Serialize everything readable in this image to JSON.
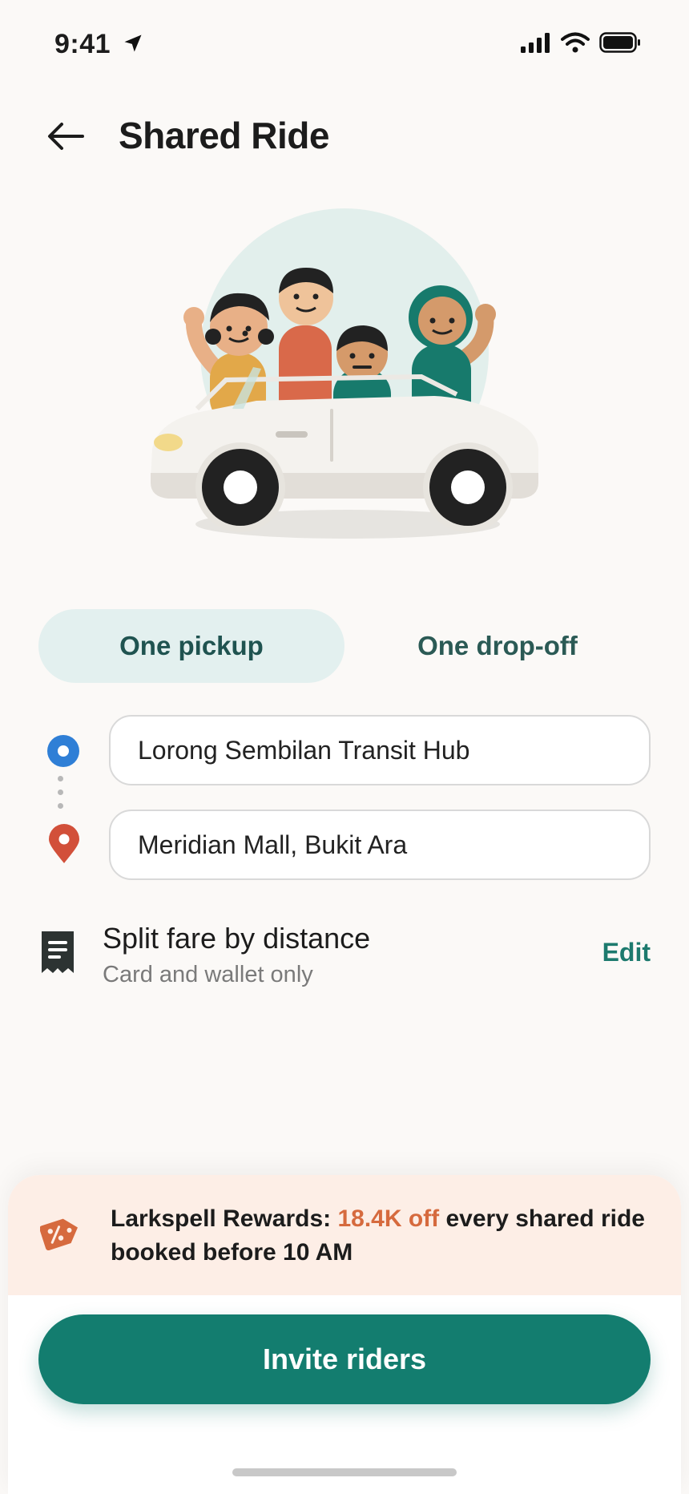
{
  "status_bar": {
    "time": "9:41"
  },
  "header": {
    "title": "Shared Ride"
  },
  "segmented": {
    "options": [
      {
        "label": "One pickup",
        "active": true
      },
      {
        "label": "One drop-off",
        "active": false
      }
    ]
  },
  "route": {
    "pickup": "Lorong Sembilan Transit Hub",
    "dropoff": "Meridian Mall, Bukit Ara"
  },
  "fare": {
    "title": "Split fare by distance",
    "subtitle": "Card and wallet only",
    "edit_label": "Edit"
  },
  "promo": {
    "prefix": "Larkspell Rewards: ",
    "highlight": "18.4K off",
    "suffix": " every shared ride booked before 10 AM"
  },
  "cta": {
    "label": "Invite riders"
  },
  "colors": {
    "brand": "#137d6f",
    "accent": "#d66a3e",
    "pickup_pin": "#2f7fd6",
    "dropoff_pin": "#d2503a"
  }
}
